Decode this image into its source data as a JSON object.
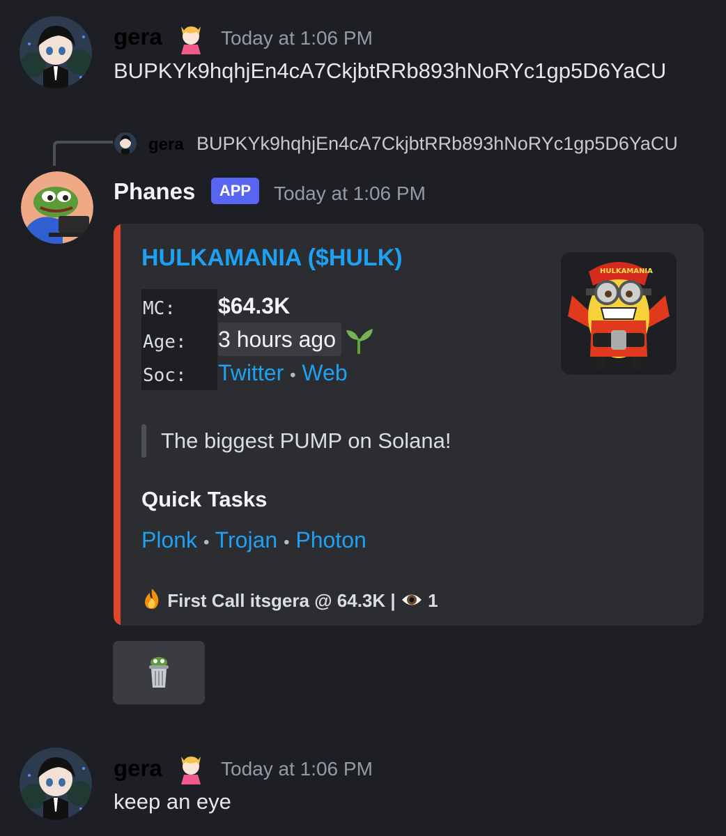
{
  "messages": [
    {
      "author": "gera",
      "timestamp": "Today at 1:06 PM",
      "content": "BUPKYk9hqhjEn4cA7CkjbtRRb893hNoRYc1gp5D6YaCU"
    },
    {
      "reply": {
        "author": "gera",
        "content": "BUPKYk9hqhjEn4cA7CkjbtRRb893hNoRYc1gp5D6YaCU"
      },
      "author": "Phanes",
      "badge": "APP",
      "timestamp": "Today at 1:06 PM",
      "embed": {
        "accent_color": "#e2452c",
        "title": "HULKAMANIA ($HULK)",
        "fields": [
          {
            "label": "MC:",
            "value": "$64.3K"
          },
          {
            "label": "Age:",
            "value": "3 hours ago",
            "emoji": "seedling-icon"
          },
          {
            "label": "Soc:",
            "links": [
              "Twitter",
              "Web"
            ],
            "separator": "•"
          }
        ],
        "quote": "The biggest PUMP on Solana!",
        "quick_tasks_heading": "Quick Tasks",
        "quick_tasks": [
          "Plonk",
          "Trojan",
          "Photon"
        ],
        "separator": "•",
        "footer": {
          "fire_icon": "fire-icon",
          "text": "First Call itsgera @ 64.3K |",
          "eye_icon": "eye-icon",
          "count": "1"
        }
      },
      "button_icon": "trash-can-pepe-icon"
    },
    {
      "author": "gera",
      "timestamp": "Today at 1:06 PM",
      "content": "keep an eye"
    }
  ],
  "colors": {
    "background": "#1e1f24",
    "embed_background": "#2b2d31",
    "link": "#1ea1f2",
    "badge": "#5865f2",
    "gera_name": "#000000"
  }
}
